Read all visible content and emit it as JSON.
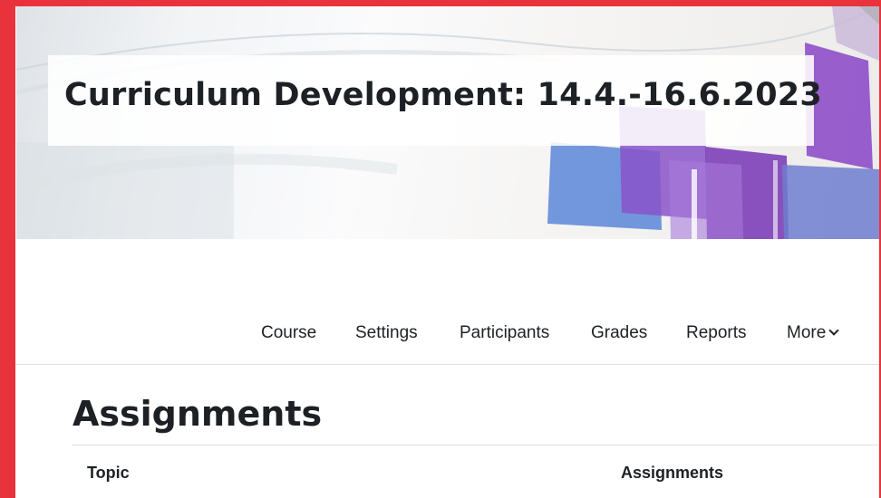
{
  "course": {
    "title": "Curriculum Development: 14.4.-16.6.2023"
  },
  "nav": {
    "items": [
      {
        "label": "Course"
      },
      {
        "label": "Settings"
      },
      {
        "label": "Participants"
      },
      {
        "label": "Grades"
      },
      {
        "label": "Reports"
      },
      {
        "label": "More"
      }
    ],
    "more_icon": "chevron-down-icon"
  },
  "page": {
    "heading": "Assignments"
  },
  "table": {
    "columns": [
      "Topic",
      "Assignments"
    ]
  },
  "colors": {
    "frame": "#e8333c",
    "text": "#1d2125",
    "divider": "#dee2e6"
  }
}
